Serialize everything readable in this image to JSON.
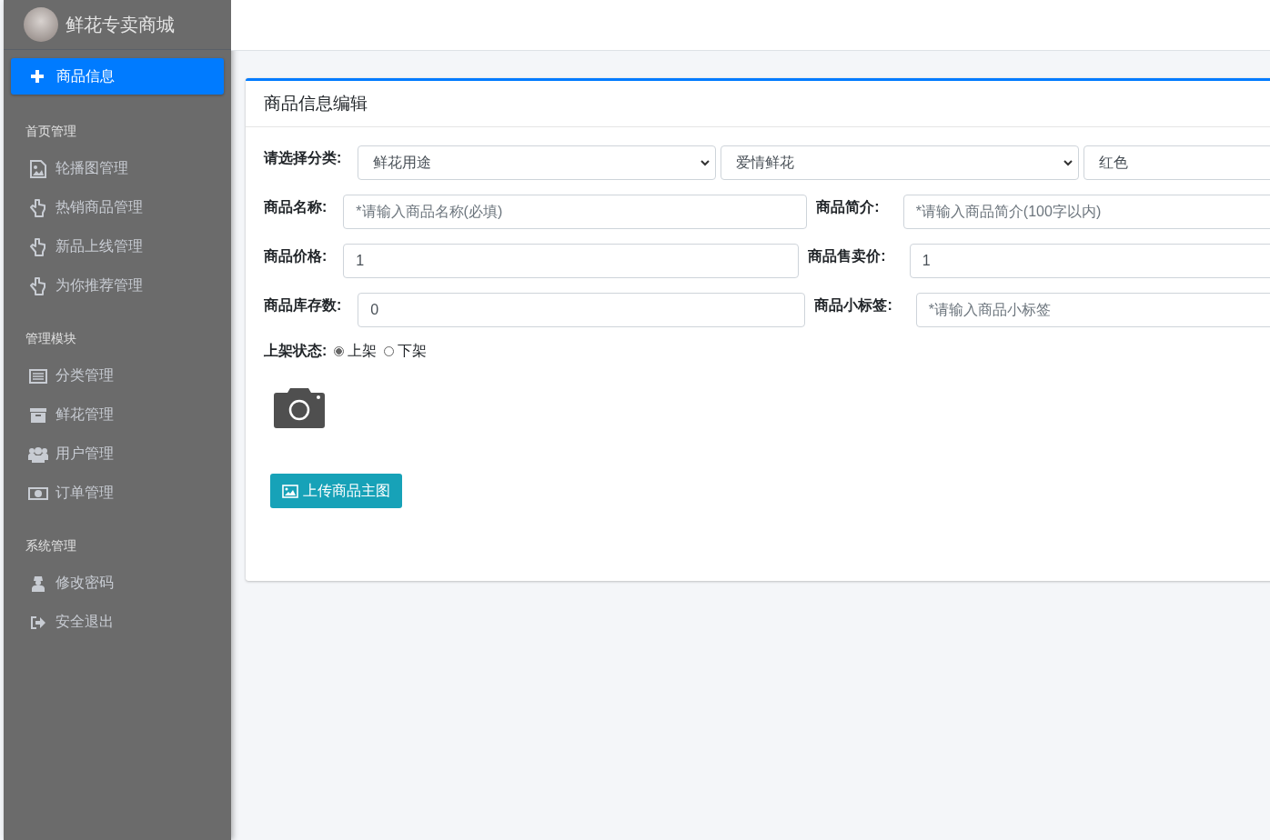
{
  "brand": {
    "title": "鲜花专卖商城"
  },
  "sidebar": {
    "top_item": {
      "label": "商品信息",
      "selected": true
    },
    "sections": [
      {
        "heading": "首页管理",
        "items": [
          {
            "label": "轮播图管理",
            "kind": "image",
            "selected": false
          },
          {
            "label": "热销商品管理",
            "kind": "hand",
            "selected": false
          },
          {
            "label": "新品上线管理",
            "kind": "hand",
            "selected": false
          },
          {
            "label": "为你推荐管理",
            "kind": "hand",
            "selected": false
          }
        ]
      },
      {
        "heading": "管理模块",
        "items": [
          {
            "label": "分类管理",
            "kind": "list",
            "selected": false
          },
          {
            "label": "鲜花管理",
            "kind": "archive",
            "selected": false
          },
          {
            "label": "用户管理",
            "kind": "users",
            "selected": false
          },
          {
            "label": "订单管理",
            "kind": "money",
            "selected": false
          }
        ]
      },
      {
        "heading": "系统管理",
        "items": [
          {
            "label": "修改密码",
            "kind": "user",
            "selected": false
          },
          {
            "label": "安全退出",
            "kind": "exit",
            "selected": false
          }
        ]
      }
    ]
  },
  "card": {
    "title": "商品信息编辑",
    "category": {
      "label": "请选择分类:",
      "selects": [
        {
          "value": "鲜花用途",
          "kind": "dropdown"
        },
        {
          "value": "爱情鲜花",
          "kind": "dropdown"
        },
        {
          "value": "红色",
          "kind": "plain"
        }
      ]
    },
    "field_rows": [
      [
        {
          "label": "商品名称:",
          "placeholder": "*请输入商品名称(必填)"
        },
        {
          "label": "商品简介:",
          "placeholder": "*请输入商品简介(100字以内)"
        }
      ],
      [
        {
          "label": "商品价格:",
          "value": "1"
        },
        {
          "label": "商品售卖价:",
          "value": "1"
        }
      ],
      [
        {
          "label": "商品库存数:",
          "value": "0"
        },
        {
          "label": "商品小标签:",
          "placeholder": "*请输入商品小标签"
        }
      ]
    ],
    "status": {
      "label": "上架状态:",
      "options": [
        {
          "label": "上架",
          "selected": true
        },
        {
          "label": "下架",
          "selected": false
        }
      ]
    },
    "upload_button": {
      "label": "上传商品主图"
    }
  }
}
